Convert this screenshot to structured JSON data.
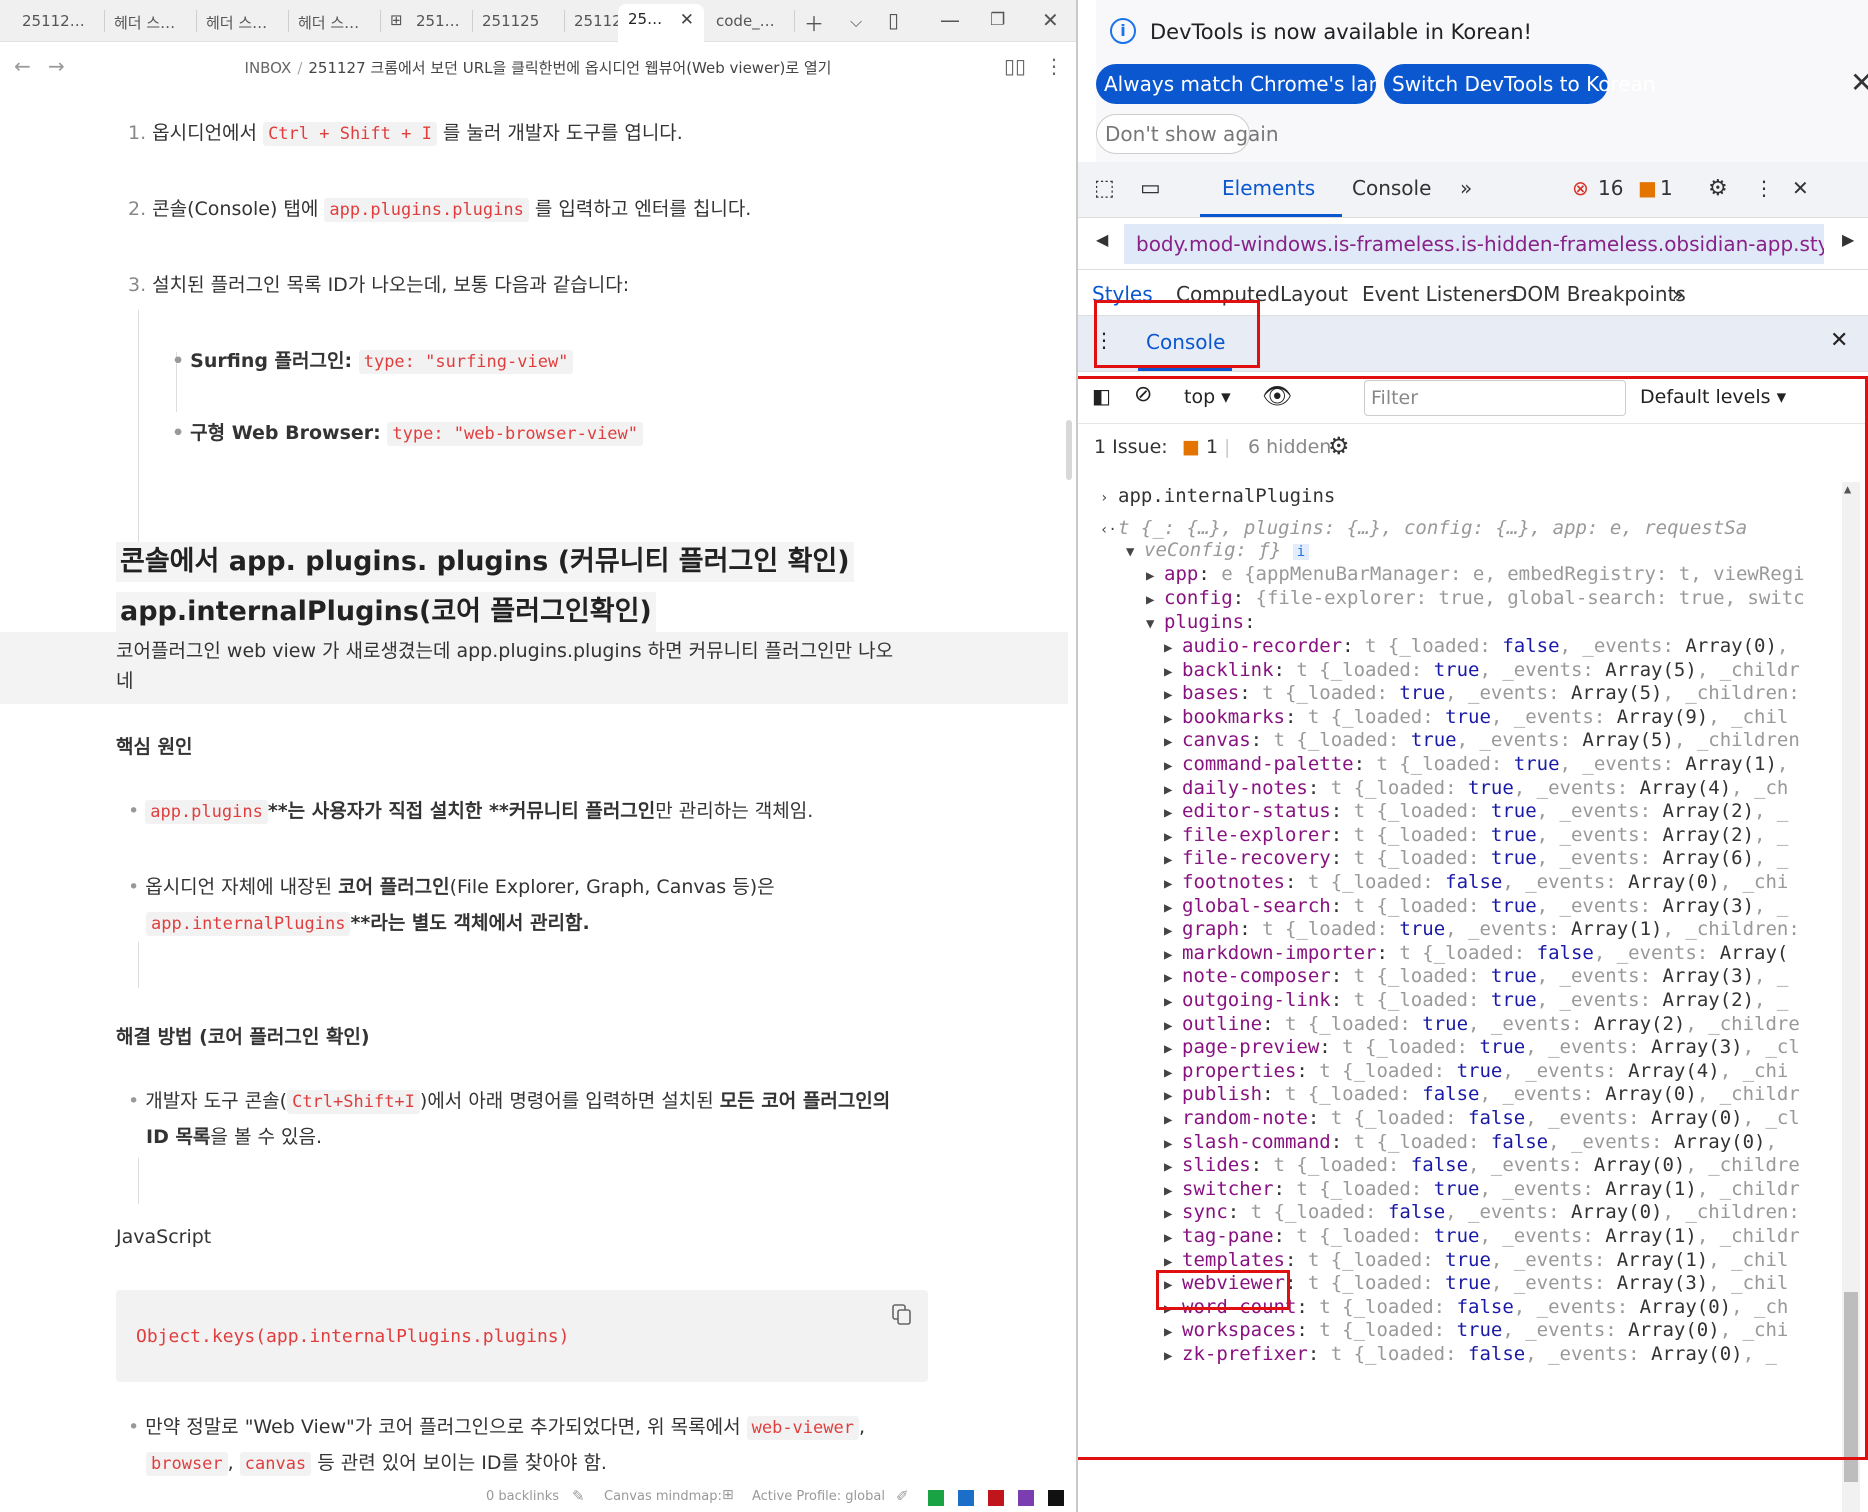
{
  "tabs": [
    "25112…",
    "헤더 스…",
    "헤더 스…",
    "헤더 스…",
    "251…",
    "251125",
    "25112…",
    "25…",
    "code_…"
  ],
  "breadcrumb": {
    "root": "INBOX",
    "sep": "/",
    "current": "251127 크롬에서 보던 URL을 클릭한번에 옵시디언 웹뷰어(Web viewer)로 열기"
  },
  "note": {
    "step1": {
      "num": "1.",
      "pre": "옵시디언에서 ",
      "code": "Ctrl + Shift + I",
      "post": " 를 눌러 개발자 도구를 엽니다."
    },
    "step2": {
      "num": "2.",
      "pre": "콘솔(Console) 탭에 ",
      "code": "app.plugins.plugins",
      "post": " 를 입력하고 엔터를 칩니다."
    },
    "step3": {
      "num": "3.",
      "text": "설치된 플러그인 목록 ID가 나오는데, 보통 다음과 같습니다:"
    },
    "sub1": {
      "label": "Surfing 플러그인:",
      "code": "type: \"surfing-view\""
    },
    "sub2": {
      "label": "구형 Web Browser:",
      "code": "type: \"web-browser-view\""
    },
    "heading_line1": "콘솔에서 app. plugins. plugins (커뮤니티 플러그인 확인)",
    "heading_line2": "app.internalPlugins(코어 플러그인확인)",
    "highlight_line1": "코어플러그인 web view 가 새로생겼는데 app.plugins.plugins 하면 커뮤니티 플러그인만 나오",
    "highlight_line2": "네",
    "section1_title": "핵심 원인",
    "s1_b1": {
      "code": "app.plugins",
      "bold": "**는 사용자가 직접 설치한 **커뮤니티 플러그인",
      "post": "만 관리하는 객체임."
    },
    "s1_b2": {
      "pre": "옵시디언 자체에 내장된 ",
      "bold": "코어 플러그인",
      "post": "(File Explorer, Graph, Canvas 등)은",
      "code": "app.internalPlugins",
      "bold2": "**라는 별도 객체에서 관리함."
    },
    "section2_title": "해결 방법 (코어 플러그인 확인)",
    "s2_b1": {
      "pre": "개발자 도구 콘솔(",
      "code": "Ctrl+Shift+I",
      "mid": ")에서 아래 명령어를 입력하면 설치된 ",
      "bold": "모든 코어 플러그인의",
      "bold2": "ID 목록",
      "post": "을 볼 수 있음."
    },
    "lang_label": "JavaScript",
    "code_line": "Object.keys(app.internalPlugins.plugins)",
    "s2_b2": {
      "pre": "만약 정말로 \"Web View\"가 코어 플러그인으로 추가되었다면, 위 목록에서 ",
      "code1": "web-viewer",
      "sep": ",",
      "code2": "browser",
      "code3": "canvas",
      "post": " 등 관련 있어 보이는 ID를 찾아야 함."
    }
  },
  "statusbar": {
    "backlinks": "0 backlinks",
    "canvas": "Canvas mindmap:",
    "profile": "Active Profile: global",
    "swatches": [
      "#1aa344",
      "#1b6fc9",
      "#c0151b",
      "#7a3eb1",
      "#111111"
    ]
  },
  "devtools": {
    "info_text": "DevTools is now available in Korean!",
    "btn_match": "Always match Chrome's language",
    "btn_switch": "Switch DevTools to Korean",
    "btn_dont": "Don't show again",
    "tab_elements": "Elements",
    "tab_console": "Console",
    "errors": "16",
    "warnings": "1",
    "crumb": "body.mod-windows.is-frameless.is-hidden-frameless.obsidian-app.styled-",
    "subtabs": [
      "Styles",
      "Computed",
      "Layout",
      "Event Listeners",
      "DOM Breakpoints"
    ],
    "drawer_tab": "Console",
    "context": "top",
    "filter_placeholder": "Filter",
    "levels": "Default levels",
    "issues_label": "1 Issue:",
    "issues_count": "1",
    "hidden": "6 hidden",
    "input_cmd": "app.internalPlugins",
    "result_line1": "t {_: {…}, plugins: {…}, config: {…}, app: e, requestSa",
    "result_line2": "veConfig: ƒ}",
    "app_row": {
      "key": "app",
      "val": "e {appMenuBarManager: e, embedRegistry: t, viewRegi"
    },
    "config_row": {
      "key": "config",
      "val": "{file-explorer: true, global-search: true, switc"
    },
    "plugins_key": "plugins",
    "plugins": [
      {
        "name": "audio-recorder",
        "loaded": "false",
        "events": "Array(0)",
        "tail": ","
      },
      {
        "name": "backlink",
        "loaded": "true",
        "events": "Array(5)",
        "tail": ", _childr"
      },
      {
        "name": "bases",
        "loaded": "true",
        "events": "Array(5)",
        "tail": ", _children:"
      },
      {
        "name": "bookmarks",
        "loaded": "true",
        "events": "Array(9)",
        "tail": ", _chil"
      },
      {
        "name": "canvas",
        "loaded": "true",
        "events": "Array(5)",
        "tail": ", _children"
      },
      {
        "name": "command-palette",
        "loaded": "true",
        "events": "Array(1)",
        "tail": ","
      },
      {
        "name": "daily-notes",
        "loaded": "true",
        "events": "Array(4)",
        "tail": ", _ch"
      },
      {
        "name": "editor-status",
        "loaded": "true",
        "events": "Array(2)",
        "tail": ", _"
      },
      {
        "name": "file-explorer",
        "loaded": "true",
        "events": "Array(2)",
        "tail": ", _"
      },
      {
        "name": "file-recovery",
        "loaded": "true",
        "events": "Array(6)",
        "tail": ", _"
      },
      {
        "name": "footnotes",
        "loaded": "false",
        "events": "Array(0)",
        "tail": ", _chi"
      },
      {
        "name": "global-search",
        "loaded": "true",
        "events": "Array(3)",
        "tail": ", _"
      },
      {
        "name": "graph",
        "loaded": "true",
        "events": "Array(1)",
        "tail": ", _children:"
      },
      {
        "name": "markdown-importer",
        "loaded": "false",
        "events": "Array(",
        "tail": ""
      },
      {
        "name": "note-composer",
        "loaded": "true",
        "events": "Array(3)",
        "tail": ", _"
      },
      {
        "name": "outgoing-link",
        "loaded": "true",
        "events": "Array(2)",
        "tail": ", _"
      },
      {
        "name": "outline",
        "loaded": "true",
        "events": "Array(2)",
        "tail": ", _childre"
      },
      {
        "name": "page-preview",
        "loaded": "true",
        "events": "Array(3)",
        "tail": ", _cl"
      },
      {
        "name": "properties",
        "loaded": "true",
        "events": "Array(4)",
        "tail": ", _chi"
      },
      {
        "name": "publish",
        "loaded": "false",
        "events": "Array(0)",
        "tail": ", _childr"
      },
      {
        "name": "random-note",
        "loaded": "false",
        "events": "Array(0)",
        "tail": ", _cl"
      },
      {
        "name": "slash-command",
        "loaded": "false",
        "events": "Array(0)",
        "tail": ","
      },
      {
        "name": "slides",
        "loaded": "false",
        "events": "Array(0)",
        "tail": ", _childre"
      },
      {
        "name": "switcher",
        "loaded": "true",
        "events": "Array(1)",
        "tail": ", _childr"
      },
      {
        "name": "sync",
        "loaded": "false",
        "events": "Array(0)",
        "tail": ", _children:"
      },
      {
        "name": "tag-pane",
        "loaded": "true",
        "events": "Array(1)",
        "tail": ", _childr"
      },
      {
        "name": "templates",
        "loaded": "true",
        "events": "Array(1)",
        "tail": ", _chil"
      },
      {
        "name": "webviewer",
        "loaded": "true",
        "events": "Array(3)",
        "tail": ", _chil"
      },
      {
        "name": "word-count",
        "loaded": "false",
        "events": "Array(0)",
        "tail": ", _ch"
      },
      {
        "name": "workspaces",
        "loaded": "true",
        "events": "Array(0)",
        "tail": ", _chi"
      },
      {
        "name": "zk-prefixer",
        "loaded": "false",
        "events": "Array(0)",
        "tail": ", _"
      }
    ]
  }
}
